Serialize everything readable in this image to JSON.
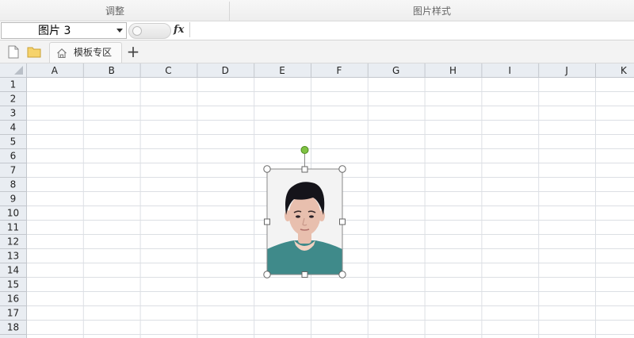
{
  "ribbon": {
    "groups": [
      {
        "label": "调整"
      },
      {
        "label": "图片样式"
      }
    ]
  },
  "formula_bar": {
    "name_box": "图片 3",
    "fx_label": "fx",
    "formula": ""
  },
  "tabs": [
    {
      "label": "模板专区"
    }
  ],
  "add_tab_label": "+",
  "sheet": {
    "columns": [
      "A",
      "B",
      "C",
      "D",
      "E",
      "F",
      "G",
      "H",
      "I",
      "J",
      "K"
    ],
    "rows": [
      "1",
      "2",
      "3",
      "4",
      "5",
      "6",
      "7",
      "8",
      "9",
      "10",
      "11",
      "12",
      "13",
      "14",
      "15",
      "16",
      "17",
      "18"
    ]
  },
  "picture": {
    "name": "图片 3",
    "description": "ID portrait photo, selected with resize handles",
    "background_color": "#f3f3f3",
    "shirt_color": "#3f8a8a",
    "hair_color": "#15141a",
    "skin_color": "#e8bfae"
  },
  "colors": {
    "header_bg": "#e9edf2",
    "grid_line": "#dcdfe4",
    "header_line": "#c3c7cd",
    "rotate_handle": "#7fc242"
  }
}
